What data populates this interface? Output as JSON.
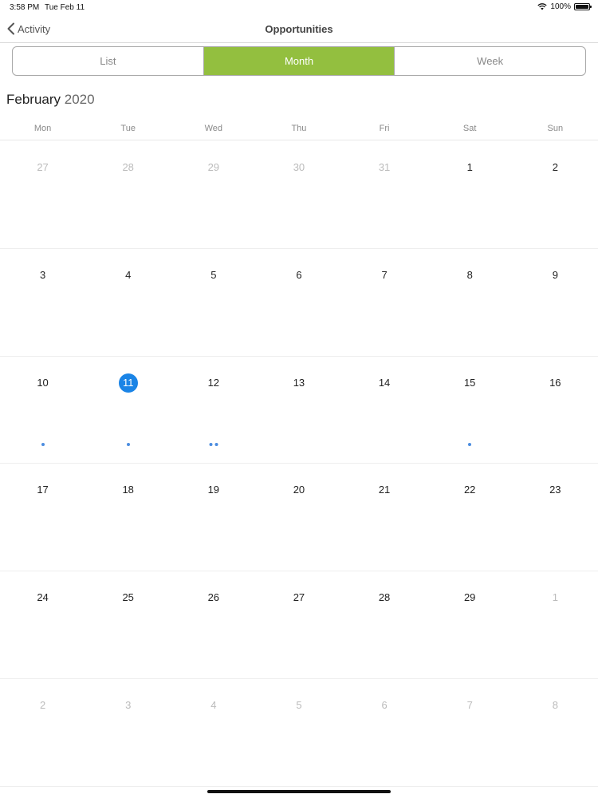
{
  "status_bar": {
    "time": "3:58 PM",
    "date": "Tue Feb 11",
    "battery": "100%"
  },
  "nav": {
    "back_label": "Activity",
    "title": "Opportunities"
  },
  "segments": [
    {
      "label": "List",
      "active": false
    },
    {
      "label": "Month",
      "active": true
    },
    {
      "label": "Week",
      "active": false
    }
  ],
  "calendar": {
    "month": "February",
    "year": "2020",
    "weekdays": [
      "Mon",
      "Tue",
      "Wed",
      "Thu",
      "Fri",
      "Sat",
      "Sun"
    ],
    "weeks": [
      [
        {
          "day": "27",
          "other": true
        },
        {
          "day": "28",
          "other": true
        },
        {
          "day": "29",
          "other": true
        },
        {
          "day": "30",
          "other": true
        },
        {
          "day": "31",
          "other": true
        },
        {
          "day": "1"
        },
        {
          "day": "2"
        }
      ],
      [
        {
          "day": "3"
        },
        {
          "day": "4"
        },
        {
          "day": "5"
        },
        {
          "day": "6"
        },
        {
          "day": "7"
        },
        {
          "day": "8"
        },
        {
          "day": "9"
        }
      ],
      [
        {
          "day": "10",
          "events": 1
        },
        {
          "day": "11",
          "today": true,
          "events": 1
        },
        {
          "day": "12",
          "events": 2
        },
        {
          "day": "13"
        },
        {
          "day": "14"
        },
        {
          "day": "15",
          "events": 1
        },
        {
          "day": "16"
        }
      ],
      [
        {
          "day": "17"
        },
        {
          "day": "18"
        },
        {
          "day": "19"
        },
        {
          "day": "20"
        },
        {
          "day": "21"
        },
        {
          "day": "22"
        },
        {
          "day": "23"
        }
      ],
      [
        {
          "day": "24"
        },
        {
          "day": "25"
        },
        {
          "day": "26"
        },
        {
          "day": "27"
        },
        {
          "day": "28"
        },
        {
          "day": "29"
        },
        {
          "day": "1",
          "other": true
        }
      ],
      [
        {
          "day": "2",
          "other": true
        },
        {
          "day": "3",
          "other": true
        },
        {
          "day": "4",
          "other": true
        },
        {
          "day": "5",
          "other": true
        },
        {
          "day": "6",
          "other": true
        },
        {
          "day": "7",
          "other": true
        },
        {
          "day": "8",
          "other": true
        }
      ]
    ]
  },
  "colors": {
    "accent": "#93bf3f",
    "today": "#1a84e6",
    "event_dot": "#4c8de0"
  }
}
